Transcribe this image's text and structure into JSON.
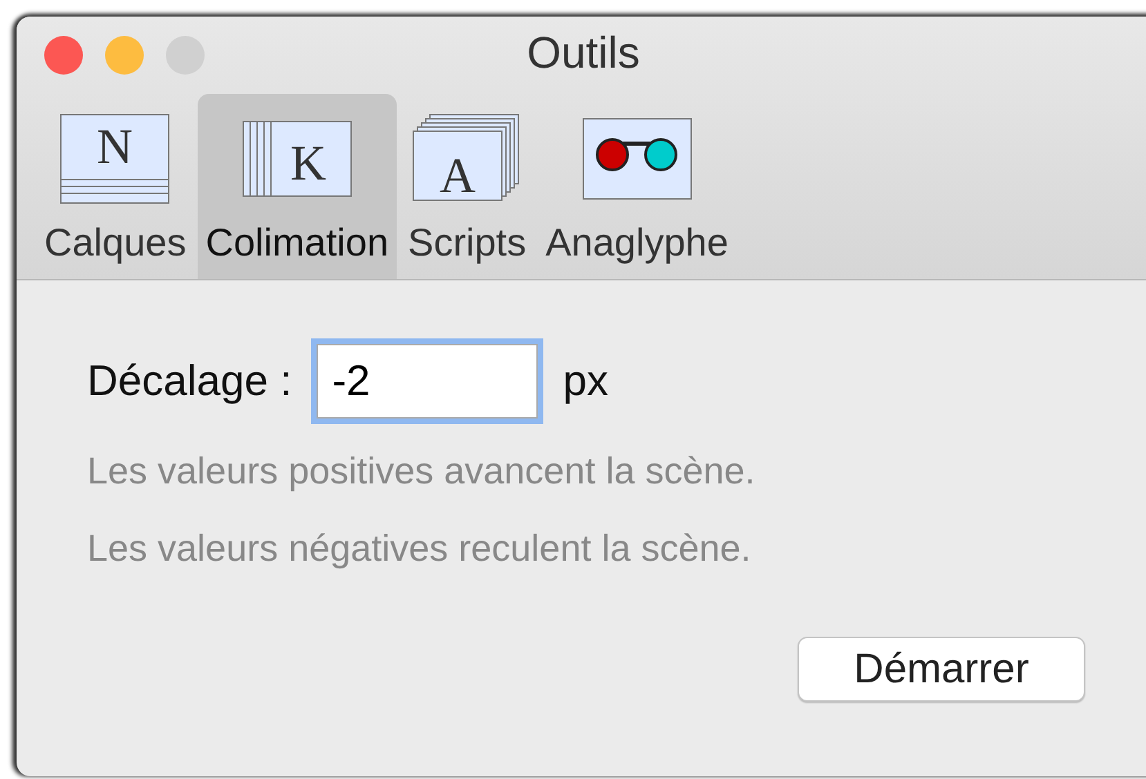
{
  "window": {
    "title": "Outils"
  },
  "tabs": [
    {
      "label": "Calques",
      "selected": false,
      "kind": "lines-below",
      "glyph": "N"
    },
    {
      "label": "Colimation",
      "selected": true,
      "kind": "lines-left",
      "glyph": "K"
    },
    {
      "label": "Scripts",
      "selected": false,
      "kind": "stack",
      "glyph": "A"
    },
    {
      "label": "Anaglyphe",
      "selected": false,
      "kind": "glasses"
    }
  ],
  "offset": {
    "label": "Décalage :",
    "value": "-2",
    "unit": "px",
    "focused": true
  },
  "hints": [
    "Les valeurs positives avancent la scène.",
    "Les valeurs négatives reculent la scène."
  ],
  "buttons": [
    "Démarrer"
  ]
}
